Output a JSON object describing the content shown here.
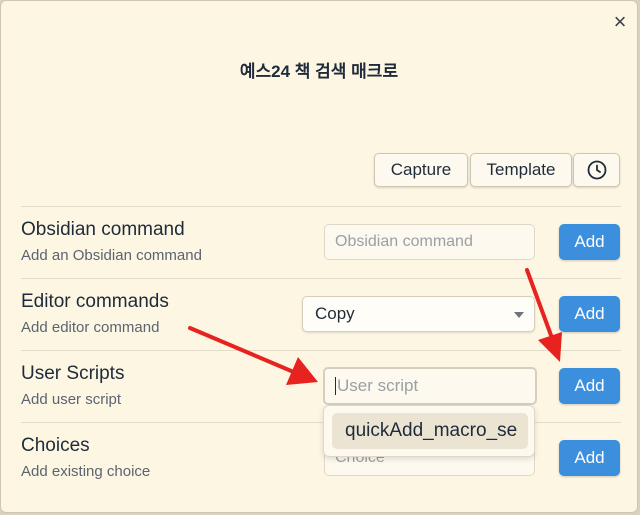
{
  "modal": {
    "title": "예스24 책 검색 매크로",
    "close_symbol": "×"
  },
  "toolbar": {
    "capture_label": "Capture",
    "template_label": "Template",
    "history_icon": "clock-icon"
  },
  "rows": {
    "obsidian": {
      "title": "Obsidian command",
      "description": "Add an Obsidian command",
      "placeholder": "Obsidian command",
      "add_label": "Add"
    },
    "editor": {
      "title": "Editor commands",
      "description": "Add editor command",
      "selected": "Copy",
      "add_label": "Add"
    },
    "scripts": {
      "title": "User Scripts",
      "description": "Add user script",
      "placeholder": "User script",
      "add_label": "Add"
    },
    "choices": {
      "title": "Choices",
      "description": "Add existing choice",
      "placeholder": "Choice",
      "add_label": "Add"
    }
  },
  "suggestions": [
    "quickAdd_macro_se"
  ],
  "colors": {
    "accent": "#3b8fdd",
    "background": "#fdf6e3",
    "annotation_arrow": "#e8231f"
  }
}
